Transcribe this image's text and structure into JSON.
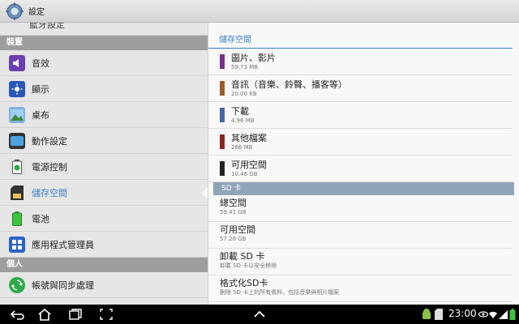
{
  "app": {
    "title": "設定"
  },
  "sidebar": {
    "partial_label": "藍牙設定",
    "sections": [
      {
        "header": "裝置",
        "items": [
          {
            "label": "音效",
            "icon": "speaker-icon"
          },
          {
            "label": "顯示",
            "icon": "display-icon"
          },
          {
            "label": "桌布",
            "icon": "wallpaper-icon"
          },
          {
            "label": "動作設定",
            "icon": "motion-icon"
          },
          {
            "label": "電源控制",
            "icon": "power-saving-icon"
          },
          {
            "label": "儲存空間",
            "icon": "sd-card-icon",
            "active": true
          },
          {
            "label": "電池",
            "icon": "battery-icon"
          },
          {
            "label": "應用程式管理員",
            "icon": "apps-grid-icon"
          }
        ]
      },
      {
        "header": "個人",
        "items": [
          {
            "label": "帳號與同步處理",
            "icon": "sync-icon"
          }
        ]
      }
    ]
  },
  "storage": {
    "title": "儲存空間",
    "items": [
      {
        "label": "圖片、影片",
        "size": "59.73 MB",
        "color": "#7a2f8f"
      },
      {
        "label": "音訊（音樂、鈴聲、播客等）",
        "size": "20.00 KB",
        "color": "#9c5b2a"
      },
      {
        "label": "下載",
        "size": "4.96 MB",
        "color": "#4a64a8"
      },
      {
        "label": "其他檔案",
        "size": "266 MB",
        "color": "#8a2323"
      },
      {
        "label": "可用空間",
        "size": "10.46 GB",
        "color": "#222222"
      }
    ]
  },
  "sd": {
    "header": "SD 卡",
    "items": [
      {
        "label": "總空間",
        "sub": "59.41 GB"
      },
      {
        "label": "可用空間",
        "sub": "57.28 GB"
      },
      {
        "label": "卸載 SD 卡",
        "sub": "卸載 SD 卡以安全移除"
      },
      {
        "label": "格式化SD卡",
        "sub": "刪除 SD 卡上的所有資料，包括音樂與相片檔案"
      }
    ]
  },
  "statusbar": {
    "time": "23:00"
  }
}
